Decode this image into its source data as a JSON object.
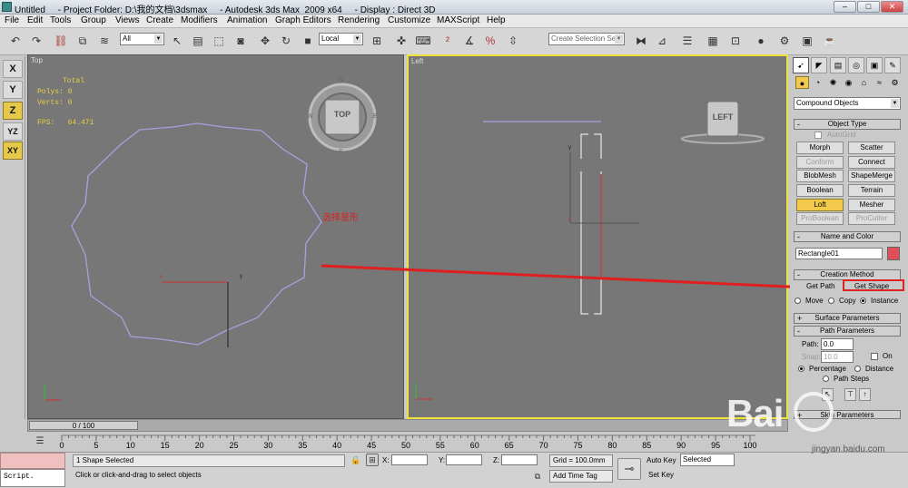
{
  "title_bar": {
    "text": "Untitled     - Project Folder: D:\\我的文档\\3dsmax     - Autodesk 3ds Max  2009 x64     - Display : Direct 3D",
    "controls": [
      "–",
      "□",
      "✕"
    ]
  },
  "menu": {
    "items": [
      "File",
      "Edit",
      "Tools",
      "Group",
      "Views",
      "Create",
      "Modifiers",
      "Animation",
      "Graph Editors",
      "Rendering",
      "Customize",
      "MAXScript",
      "Help"
    ]
  },
  "toolbar": {
    "filter_value": "All",
    "coord_value": "Local",
    "selection_set_placeholder": "Create Selection Se"
  },
  "axis_constraints": [
    "X",
    "Y",
    "Z",
    "YZ",
    "XY"
  ],
  "viewport_top": {
    "label": "Top",
    "stats": {
      "total": "Total",
      "polys": "Polys: 0",
      "verts": "Verts: 0",
      "fps": "FPS:   64.471"
    },
    "viewcube_label": "TOP",
    "compass_letters": [
      "N",
      "E",
      "S",
      "W"
    ],
    "axis_x": "x",
    "axis_y": "y"
  },
  "viewport_left": {
    "label": "Left",
    "viewcube_label": "LEFT",
    "axis_x": "x",
    "axis_y": "y"
  },
  "annotation": {
    "text": "选择星形",
    "color": "#d82020"
  },
  "command_panel": {
    "category": "Compound Objects",
    "object_type": {
      "title": "Object Type",
      "autogrid": "AutoGrid",
      "buttons": [
        "Morph",
        "Scatter",
        "Conform",
        "Connect",
        "BlobMesh",
        "ShapeMerge",
        "Boolean",
        "Terrain",
        "Loft",
        "Mesher",
        "ProBoolean",
        "ProCutter"
      ]
    },
    "name_color": {
      "title": "Name and Color",
      "name": "Rectangle01",
      "swatch": "#e0505a"
    },
    "creation_method": {
      "title": "Creation Method",
      "get_path": "Get Path",
      "get_shape": "Get Shape",
      "move": "Move",
      "copy": "Copy",
      "instance": "Instance"
    },
    "surface_parameters": "Surface Parameters",
    "path_parameters": {
      "title": "Path Parameters",
      "path_label": "Path:",
      "path_value": "0.0",
      "snap_label": "Snap:",
      "snap_value": "10.0",
      "on_label": "On",
      "percentage": "Percentage",
      "distance": "Distance",
      "path_steps": "Path Steps"
    },
    "skin_parameters": "Skin Parameters"
  },
  "timeline": {
    "slider": "0 / 100",
    "ticks": [
      "0",
      "5",
      "10",
      "15",
      "20",
      "25",
      "30",
      "35",
      "40",
      "45",
      "50",
      "55",
      "60",
      "65",
      "70",
      "75",
      "80",
      "85",
      "90",
      "95",
      "100"
    ]
  },
  "status": {
    "selection": "1 Shape Selected",
    "prompt": "Click or click-and-drag to select objects",
    "script": "Script.",
    "x_label": "X:",
    "y_label": "Y:",
    "z_label": "Z:",
    "grid": "Grid = 100.0mm",
    "auto_key": "Auto Key",
    "set_key": "Set Key",
    "selected": "Selected",
    "add_time_tag": "Add Time Tag"
  },
  "watermark": {
    "text": "Bai",
    "sub": "jingyan.baidu.com"
  }
}
